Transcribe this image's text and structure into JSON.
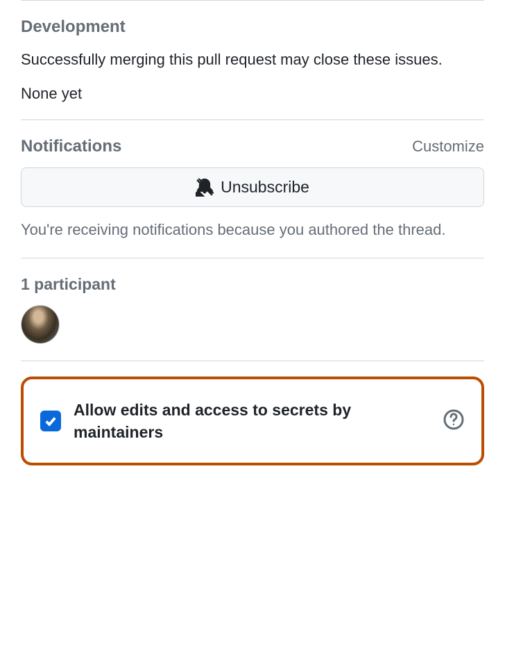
{
  "development": {
    "title": "Development",
    "description": "Successfully merging this pull request may close these issues.",
    "value": "None yet"
  },
  "notifications": {
    "title": "Notifications",
    "customize_label": "Customize",
    "unsubscribe_label": "Unsubscribe",
    "reason": "You're receiving notifications because you authored the thread."
  },
  "participants": {
    "count_label": "1 participant"
  },
  "allow_edits": {
    "label": "Allow edits and access to secrets by maintainers",
    "checked": true
  }
}
